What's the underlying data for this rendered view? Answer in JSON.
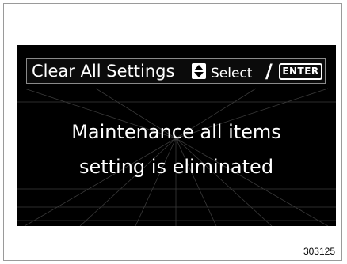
{
  "header": {
    "title": "Clear All Settings",
    "select_label": "Select",
    "slash": "/",
    "enter_label": "ENTER",
    "updown_icon": "up-down-arrows-icon"
  },
  "message": {
    "line1": "Maintenance all items",
    "line2": "setting is eliminated"
  },
  "figure_number": "303125",
  "colors": {
    "screen_background": "#000000",
    "text": "#ffffff",
    "border": "#9a9a9a"
  }
}
